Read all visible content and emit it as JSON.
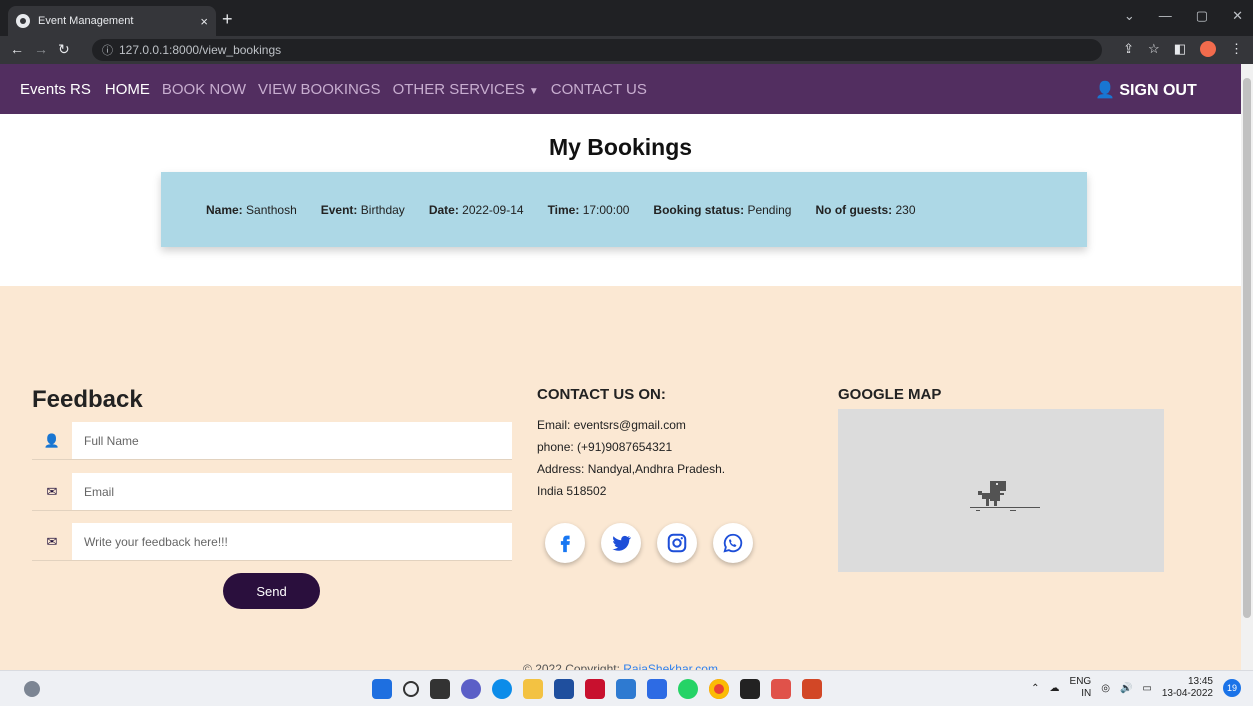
{
  "browser": {
    "tab_title": "Event Management",
    "url": "127.0.0.1:8000/view_bookings"
  },
  "nav": {
    "brand": "Events RS",
    "links": [
      "HOME",
      "BOOK NOW",
      "VIEW BOOKINGS",
      "OTHER SERVICES",
      "CONTACT US"
    ],
    "signout": "SIGN OUT"
  },
  "bookings": {
    "heading": "My Bookings",
    "labels": {
      "name": "Name:",
      "event": "Event:",
      "date": "Date:",
      "time": "Time:",
      "status": "Booking status:",
      "guests": "No of guests:"
    },
    "item": {
      "name": "Santhosh",
      "event": "Birthday",
      "date": "2022-09-14",
      "time": "17:00:00",
      "status": "Pending",
      "guests": "230"
    }
  },
  "feedback": {
    "title": "Feedback",
    "name_placeholder": "Full Name",
    "email_placeholder": "Email",
    "message_placeholder": "Write your feedback here!!!",
    "send_label": "Send"
  },
  "contact": {
    "title": "CONTACT US ON:",
    "email": "Email: eventsrs@gmail.com",
    "phone": "phone: (+91)9087654321",
    "address1": "Address: Nandyal,Andhra Pradesh.",
    "address2": "India 518502",
    "social_icons": [
      "facebook-icon",
      "twitter-icon",
      "instagram-icon",
      "whatsapp-icon"
    ]
  },
  "map": {
    "title": "GOOGLE MAP"
  },
  "footer": {
    "copyright_prefix": "© 2022 Copyright: ",
    "copyright_link": "RajaShekhar.com"
  },
  "taskbar": {
    "lang": "ENG",
    "region": "IN",
    "time": "13:45",
    "date": "13-04-2022",
    "notifications": "19"
  },
  "colors": {
    "nav_bg": "#522e60",
    "card_bg": "#add8e6",
    "footer_bg": "#fbe8d3",
    "button_bg": "#2a0f3d"
  }
}
